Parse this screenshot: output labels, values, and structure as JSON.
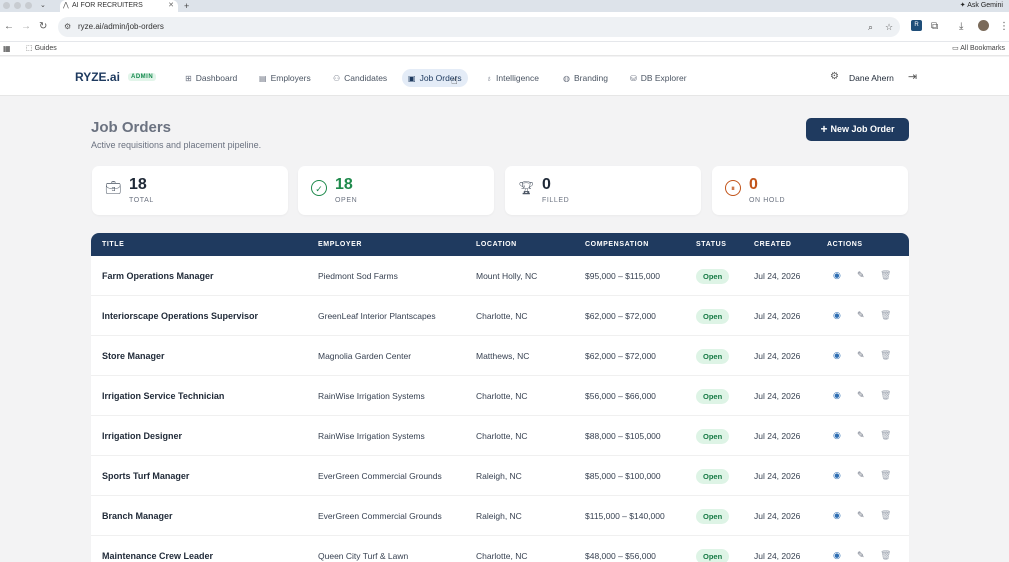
{
  "browser": {
    "tab_title": "AI FOR RECRUITERS",
    "url": "ryze.ai/admin/job-orders",
    "ask_gemini": "Ask Gemini",
    "bookmarks": {
      "guides": "Guides",
      "all_bookmarks": "All Bookmarks"
    }
  },
  "header": {
    "brand": "RYZE.ai",
    "badge": "ADMIN",
    "nav": [
      {
        "label": "Dashboard",
        "icon": "grid-icon"
      },
      {
        "label": "Employers",
        "icon": "building-icon"
      },
      {
        "label": "Candidates",
        "icon": "users-icon"
      },
      {
        "label": "Job Orders",
        "icon": "briefcase-icon",
        "active": true
      },
      {
        "label": "Intelligence",
        "icon": "bulb-icon"
      },
      {
        "label": "Branding",
        "icon": "palette-icon"
      },
      {
        "label": "DB Explorer",
        "icon": "database-icon"
      }
    ],
    "user_name": "Dane Ahern"
  },
  "page": {
    "title": "Job Orders",
    "subtitle": "Active requisitions and placement pipeline.",
    "new_button": "New Job Order"
  },
  "stats": [
    {
      "value": "18",
      "label": "TOTAL",
      "color": "#1f2937",
      "icon": "briefcase-icon"
    },
    {
      "value": "18",
      "label": "OPEN",
      "color": "#1f8a4c",
      "icon": "check-circle-icon"
    },
    {
      "value": "0",
      "label": "FILLED",
      "color": "#1f2937",
      "icon": "trophy-icon"
    },
    {
      "value": "0",
      "label": "ON HOLD",
      "color": "#c2541a",
      "icon": "pause-circle-icon"
    }
  ],
  "table": {
    "columns": [
      "TITLE",
      "EMPLOYER",
      "LOCATION",
      "COMPENSATION",
      "STATUS",
      "CREATED",
      "ACTIONS"
    ],
    "rows": [
      {
        "title": "Farm Operations Manager",
        "employer": "Piedmont Sod Farms",
        "location": "Mount Holly, NC",
        "compensation": "$95,000 – $115,000",
        "status": "Open",
        "created": "Jul 24, 2026"
      },
      {
        "title": "Interiorscape Operations Supervisor",
        "employer": "GreenLeaf Interior Plantscapes",
        "location": "Charlotte, NC",
        "compensation": "$62,000 – $72,000",
        "status": "Open",
        "created": "Jul 24, 2026"
      },
      {
        "title": "Store Manager",
        "employer": "Magnolia Garden Center",
        "location": "Matthews, NC",
        "compensation": "$62,000 – $72,000",
        "status": "Open",
        "created": "Jul 24, 2026"
      },
      {
        "title": "Irrigation Service Technician",
        "employer": "RainWise Irrigation Systems",
        "location": "Charlotte, NC",
        "compensation": "$56,000 – $66,000",
        "status": "Open",
        "created": "Jul 24, 2026"
      },
      {
        "title": "Irrigation Designer",
        "employer": "RainWise Irrigation Systems",
        "location": "Charlotte, NC",
        "compensation": "$88,000 – $105,000",
        "status": "Open",
        "created": "Jul 24, 2026"
      },
      {
        "title": "Sports Turf Manager",
        "employer": "EverGreen Commercial Grounds",
        "location": "Raleigh, NC",
        "compensation": "$85,000 – $100,000",
        "status": "Open",
        "created": "Jul 24, 2026"
      },
      {
        "title": "Branch Manager",
        "employer": "EverGreen Commercial Grounds",
        "location": "Raleigh, NC",
        "compensation": "$115,000 – $140,000",
        "status": "Open",
        "created": "Jul 24, 2026"
      },
      {
        "title": "Maintenance Crew Leader",
        "employer": "Queen City Turf & Lawn",
        "location": "Charlotte, NC",
        "compensation": "$48,000 – $56,000",
        "status": "Open",
        "created": "Jul 24, 2026"
      }
    ]
  }
}
